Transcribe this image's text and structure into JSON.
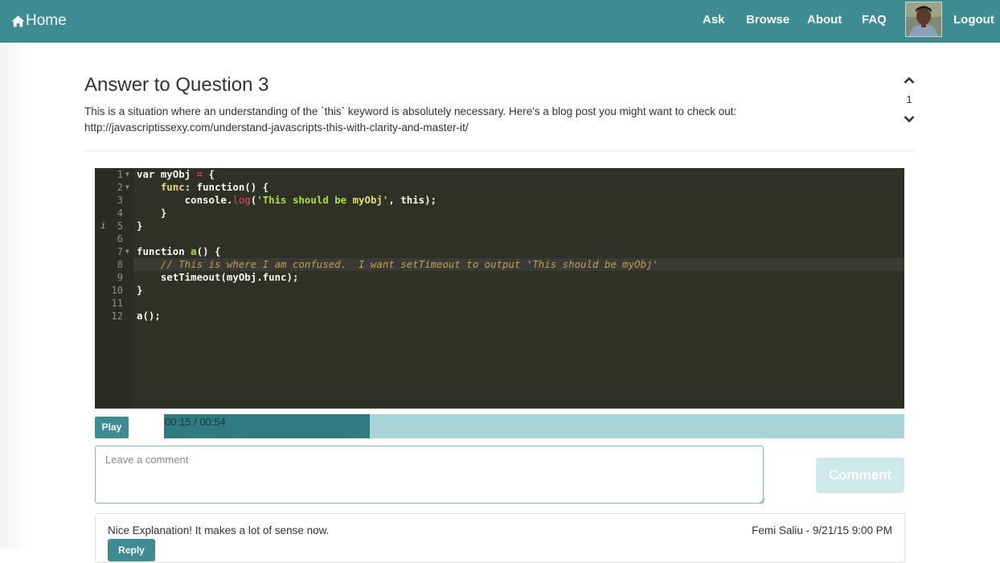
{
  "nav": {
    "home_label": "Home",
    "links": [
      "Ask",
      "Browse",
      "About",
      "FAQ"
    ],
    "logout_label": "Logout",
    "color": "#3c8c91"
  },
  "answer": {
    "title": "Answer to Question 3",
    "body_line1": "This is a situation where an understanding of the `this` keyword is absolutely necessary. Here's a blog post you might want to check out:",
    "body_line2": "http://javascriptissexy.com/understand-javascripts-this-with-clarity-and-master-it/",
    "vote_count": "1"
  },
  "editor": {
    "line_numbers": [
      "1",
      "2",
      "3",
      "4",
      "5",
      "6",
      "7",
      "8",
      "9",
      "10",
      "11",
      "12"
    ],
    "info_marker": "i",
    "code": {
      "l1_a": "var myObj ",
      "l1_b": "=",
      "l1_c": " {",
      "l2_a": "    ",
      "l2_b": "func",
      "l2_c": ": function() {",
      "l3_a": "        console.",
      "l3_b": "log",
      "l3_c": "(",
      "l3_d": "'This should be ",
      "l3_e": "myObj",
      "l3_f": "'",
      "l3_g": ", this);",
      "l4": "    }",
      "l5": "}",
      "l7_a": "function ",
      "l7_b": "a",
      "l7_c": "() {",
      "l8": "    // This is where I am confused.  I want setTimeout to output 'This should be myObj'",
      "l9": "    setTimeout(myObj.func);",
      "l10": "}",
      "l12": "a();"
    }
  },
  "player": {
    "play_label": "Play",
    "time_text": "00:15 / 00:54",
    "progress_fraction": 0.2778
  },
  "comment_form": {
    "placeholder": "Leave a comment",
    "submit_label": "Comment"
  },
  "comments": [
    {
      "text": "Nice Explanation! It makes a lot of sense now.",
      "meta": "Femi Saliu - 9/21/15 9:00 PM",
      "reply_label": "Reply"
    }
  ]
}
